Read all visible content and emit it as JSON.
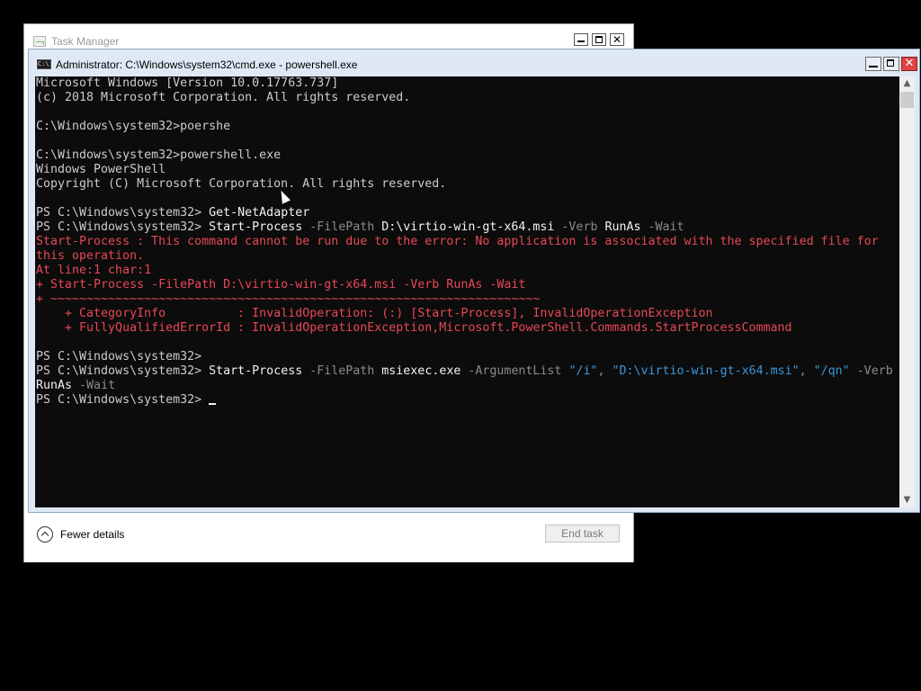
{
  "task_manager": {
    "title": "Task Manager",
    "fewer_details": "Fewer details",
    "end_task": "End task"
  },
  "cmd": {
    "title": "Administrator: C:\\Windows\\system32\\cmd.exe - powershell.exe",
    "icon_text": "C:\\",
    "lines": [
      [
        {
          "t": "Microsoft Windows [Version 10.0.17763.737]",
          "c": "g"
        }
      ],
      [
        {
          "t": "(c) 2018 Microsoft Corporation. All rights reserved.",
          "c": "g"
        }
      ],
      [],
      [
        {
          "t": "C:\\Windows\\system32>poershe",
          "c": "g"
        }
      ],
      [],
      [
        {
          "t": "C:\\Windows\\system32>powershell.exe",
          "c": "g"
        }
      ],
      [
        {
          "t": "Windows PowerShell",
          "c": "g"
        }
      ],
      [
        {
          "t": "Copyright (C) Microsoft Corporation. All rights reserved.",
          "c": "g"
        }
      ],
      [],
      [
        {
          "t": "PS C:\\Windows\\system32> ",
          "c": "g"
        },
        {
          "t": "Get-NetAdapter",
          "c": "w"
        }
      ],
      [
        {
          "t": "PS C:\\Windows\\system32> ",
          "c": "g"
        },
        {
          "t": "Start-Process ",
          "c": "w"
        },
        {
          "t": "-FilePath ",
          "c": "gray"
        },
        {
          "t": "D:\\virtio-win-gt-x64.msi ",
          "c": "w"
        },
        {
          "t": "-Verb ",
          "c": "gray"
        },
        {
          "t": "RunAs ",
          "c": "w"
        },
        {
          "t": "-Wait",
          "c": "gray"
        }
      ],
      [
        {
          "t": "Start-Process : This command cannot be run due to the error: No application is associated with the specified file for",
          "c": "err"
        }
      ],
      [
        {
          "t": "this operation.",
          "c": "err"
        }
      ],
      [
        {
          "t": "At line:1 char:1",
          "c": "err"
        }
      ],
      [
        {
          "t": "+ Start-Process -FilePath D:\\virtio-win-gt-x64.msi -Verb RunAs -Wait",
          "c": "err"
        }
      ],
      [
        {
          "t": "+ ~~~~~~~~~~~~~~~~~~~~~~~~~~~~~~~~~~~~~~~~~~~~~~~~~~~~~~~~~~~~~~~~~~~~",
          "c": "err"
        }
      ],
      [
        {
          "t": "    + CategoryInfo          : InvalidOperation: (:) [Start-Process], InvalidOperationException",
          "c": "err"
        }
      ],
      [
        {
          "t": "    + FullyQualifiedErrorId : InvalidOperationException,Microsoft.PowerShell.Commands.StartProcessCommand",
          "c": "err"
        }
      ],
      [],
      [
        {
          "t": "PS C:\\Windows\\system32>",
          "c": "g"
        }
      ],
      [
        {
          "t": "PS C:\\Windows\\system32> ",
          "c": "g"
        },
        {
          "t": "Start-Process ",
          "c": "w"
        },
        {
          "t": "-FilePath ",
          "c": "gray"
        },
        {
          "t": "msiexec.exe ",
          "c": "w"
        },
        {
          "t": "-ArgumentList ",
          "c": "gray"
        },
        {
          "t": "\"/i\"",
          "c": "str"
        },
        {
          "t": ", ",
          "c": "gray"
        },
        {
          "t": "\"D:\\virtio-win-gt-x64.msi\"",
          "c": "str"
        },
        {
          "t": ", ",
          "c": "gray"
        },
        {
          "t": "\"/qn\"",
          "c": "str"
        },
        {
          "t": " -Verb",
          "c": "gray"
        }
      ],
      [
        {
          "t": "RunAs ",
          "c": "w"
        },
        {
          "t": "-Wait",
          "c": "gray"
        }
      ],
      [
        {
          "t": "PS C:\\Windows\\system32> ",
          "c": "g"
        },
        {
          "cursor": true
        }
      ]
    ]
  }
}
